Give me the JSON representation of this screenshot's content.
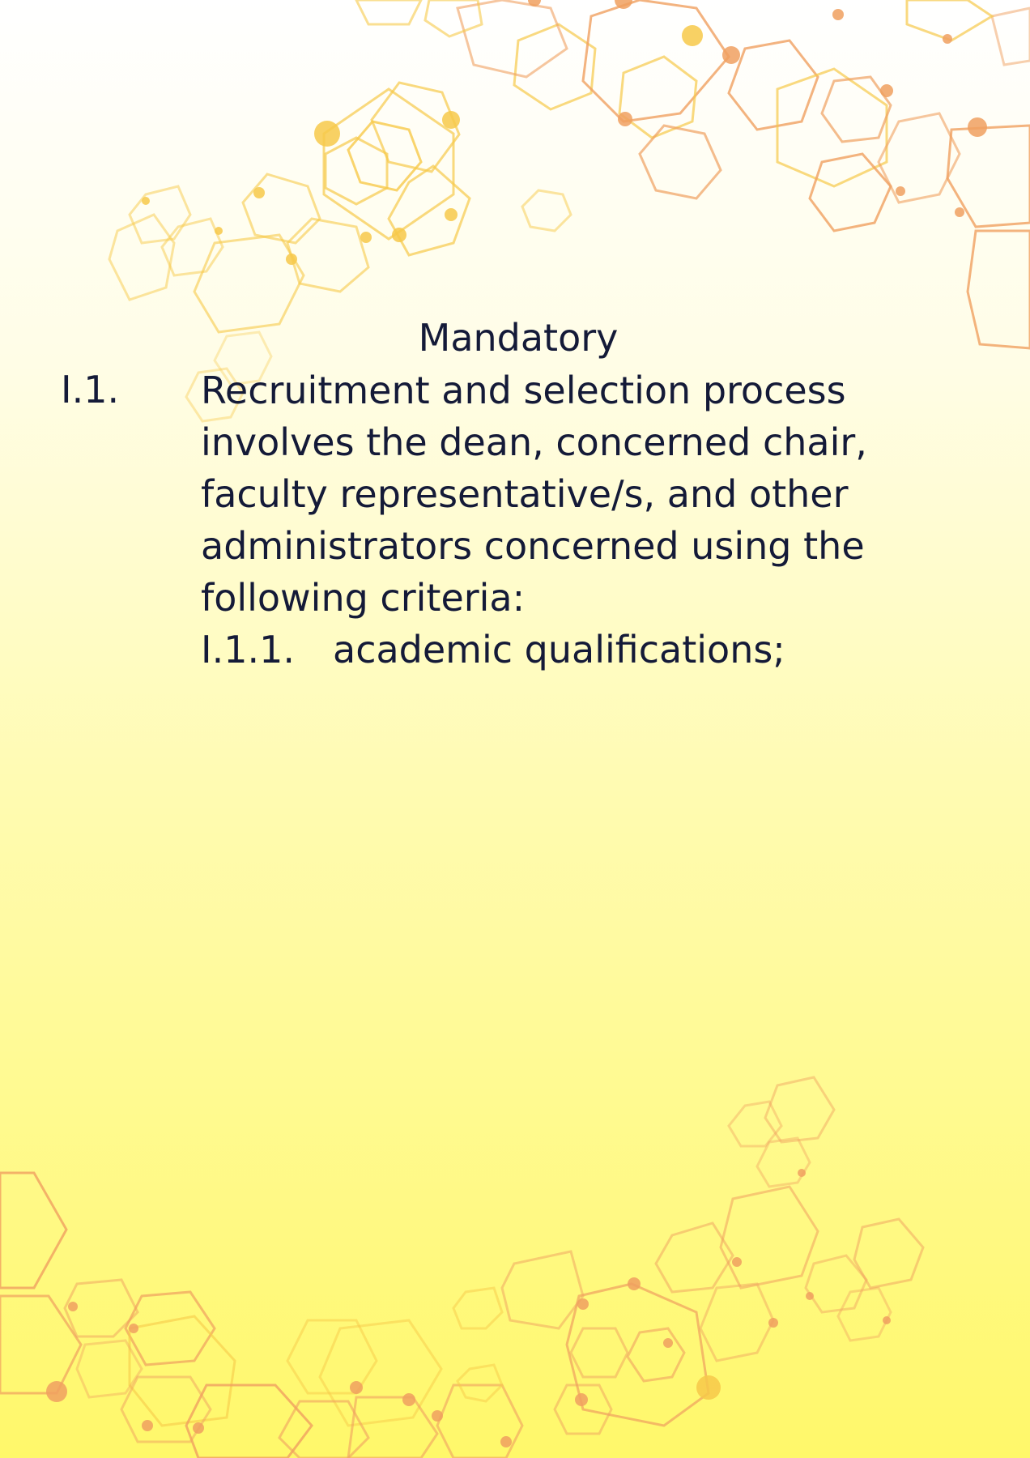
{
  "document": {
    "heading": "Mandatory",
    "item": {
      "number": "I.1.",
      "lines": [
        "Recruitment and selection process",
        "involves the dean, concerned chair,",
        "faculty representative/s, and other",
        "administrators concerned using the",
        "following criteria:"
      ]
    },
    "subitem": {
      "number": "I.1.1.",
      "text": "academic qualifications;"
    }
  },
  "colors": {
    "text": "#141a38",
    "hex_yellow": "#f7c94a",
    "hex_orange": "#f0a060",
    "background_top": "#ffffff",
    "background_bottom": "#fff86a"
  }
}
